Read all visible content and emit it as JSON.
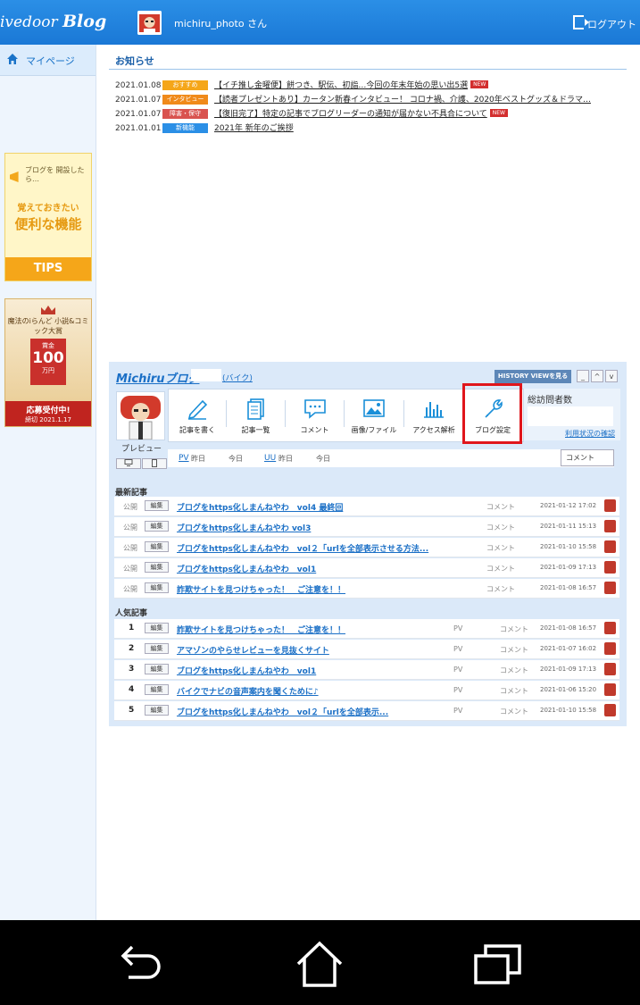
{
  "header": {
    "brand": "ivedoor",
    "brand_blog": "Blog",
    "username": "michiru_photo さん",
    "logout": "ログアウト"
  },
  "sidebar": {
    "mypage": "マイページ",
    "tips": {
      "top": "ブログを 開設したら…",
      "mid": "覚えておきたい",
      "big": "便利な機能",
      "button": "TIPS"
    },
    "award": {
      "title": "魔法のiらんど 小説&コミック大賞",
      "prize_label": "賞金",
      "prize_amount": "100",
      "prize_unit": "万円",
      "footer": "応募受付中!",
      "deadline": "締切 2021.1.17"
    }
  },
  "notices": {
    "title": "お知らせ",
    "items": [
      {
        "date": "2021.01.08",
        "tag": "おすすめ",
        "tag_color": "#f5a619",
        "text": "【イチ推し金曜便】餅つき、駅伝、初詣…今回の年末年始の思い出5選",
        "new": "NEW"
      },
      {
        "date": "2021.01.07",
        "tag": "インタビュー",
        "tag_color": "#f08a1a",
        "text": "【読者プレゼントあり】カータン新春インタビュー！ コロナ禍、介護、2020年ベストグッズ＆ドラマ…",
        "new": ""
      },
      {
        "date": "2021.01.07",
        "tag": "障害・保守",
        "tag_color": "#d9534f",
        "text": "【復旧完了】特定の記事でブログリーダーの通知が届かない不具合について",
        "new": "NEW"
      },
      {
        "date": "2021.01.01",
        "tag": "新機能",
        "tag_color": "#2b8fe6",
        "text": "2021年 新年のご挨拶",
        "new": ""
      }
    ]
  },
  "panel": {
    "blog_name": "Michiruブログ",
    "category": "(バイク)",
    "history_btn": "HISTORY VIEWを見る",
    "tools": [
      {
        "label": "記事を書く"
      },
      {
        "label": "記事一覧"
      },
      {
        "label": "コメント"
      },
      {
        "label": "画像/ファイル"
      },
      {
        "label": "アクセス解析"
      },
      {
        "label": "ブログ設定"
      }
    ],
    "visits_title": "総訪問者数",
    "usage_link": "利用状況の確認",
    "preview": "プレビュー",
    "stats": {
      "pv": "PV",
      "uu": "UU",
      "yesterday": "昨日",
      "today": "今日"
    },
    "comment_btn": "コメント",
    "recent_title": "最新記事",
    "recent": [
      {
        "status": "公開",
        "edit": "編集",
        "title": "ブログをhttps化しまんねやわ　vol4 最終回",
        "comment": "コメント",
        "date": "2021-01-12 17:02"
      },
      {
        "status": "公開",
        "edit": "編集",
        "title": "ブログをhttps化しまんねやわ vol3",
        "comment": "コメント",
        "date": "2021-01-11 15:13"
      },
      {
        "status": "公開",
        "edit": "編集",
        "title": "ブログをhttps化しまんねやわ　vol２「urlを全部表示させる方法...",
        "comment": "コメント",
        "date": "2021-01-10 15:58"
      },
      {
        "status": "公開",
        "edit": "編集",
        "title": "ブログをhttps化しまんねやわ　vol1",
        "comment": "コメント",
        "date": "2021-01-09 17:13"
      },
      {
        "status": "公開",
        "edit": "編集",
        "title": "詐欺サイトを見つけちゃった！　ご注意を！！",
        "comment": "コメント",
        "date": "2021-01-08 16:57"
      }
    ],
    "popular_title": "人気記事",
    "popular": [
      {
        "rank": "1",
        "edit": "編集",
        "title": "詐欺サイトを見つけちゃった！　ご注意を！！",
        "pv": "PV",
        "comment": "コメント",
        "date": "2021-01-08 16:57"
      },
      {
        "rank": "2",
        "edit": "編集",
        "title": "アマゾンのやらせレビューを見抜くサイト",
        "pv": "PV",
        "comment": "コメント",
        "date": "2021-01-07 16:02"
      },
      {
        "rank": "3",
        "edit": "編集",
        "title": "ブログをhttps化しまんねやわ　vol1",
        "pv": "PV",
        "comment": "コメント",
        "date": "2021-01-09 17:13"
      },
      {
        "rank": "4",
        "edit": "編集",
        "title": "バイクでナビの音声案内を聞くために♪",
        "pv": "PV",
        "comment": "コメント",
        "date": "2021-01-06 15:20"
      },
      {
        "rank": "5",
        "edit": "編集",
        "title": "ブログをhttps化しまんねやわ　vol２「urlを全部表示...",
        "pv": "PV",
        "comment": "コメント",
        "date": "2021-01-10 15:58"
      }
    ]
  },
  "icons": {
    "home": "home-icon",
    "logout": "logout-icon",
    "back": "back-arrow-icon",
    "home_nav": "home-nav-icon",
    "recents": "recent-apps-icon"
  }
}
